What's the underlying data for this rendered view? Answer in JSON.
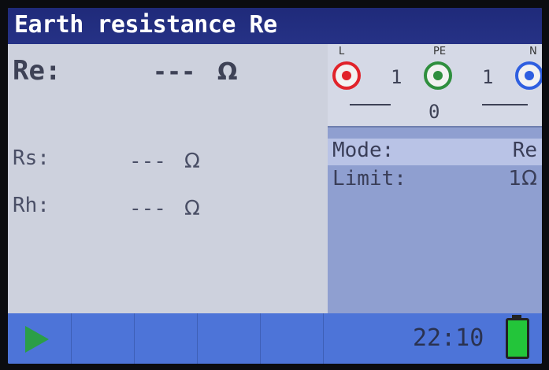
{
  "title": "Earth resistance Re",
  "measurements": {
    "re": {
      "label": "Re:",
      "value": "---",
      "unit": "Ω"
    },
    "rs": {
      "label": "Rs:",
      "value": "---",
      "unit": "Ω"
    },
    "rh": {
      "label": "Rh:",
      "value": "---",
      "unit": "Ω"
    }
  },
  "terminals": {
    "l": {
      "label": "L",
      "color": "#e1232a"
    },
    "pe": {
      "label": "PE",
      "color": "#2f8f3e"
    },
    "n": {
      "label": "N",
      "color": "#2f5fe0"
    },
    "readings": [
      "1",
      "1",
      "0"
    ]
  },
  "settings": {
    "mode": {
      "label": "Mode:",
      "value": "Re"
    },
    "limit": {
      "label": "Limit:",
      "value": "1Ω"
    }
  },
  "status": {
    "clock": "22:10",
    "battery_level": 1.0,
    "accent_color": "#4d74d8"
  },
  "icons": [
    "play-icon",
    "battery-icon"
  ]
}
